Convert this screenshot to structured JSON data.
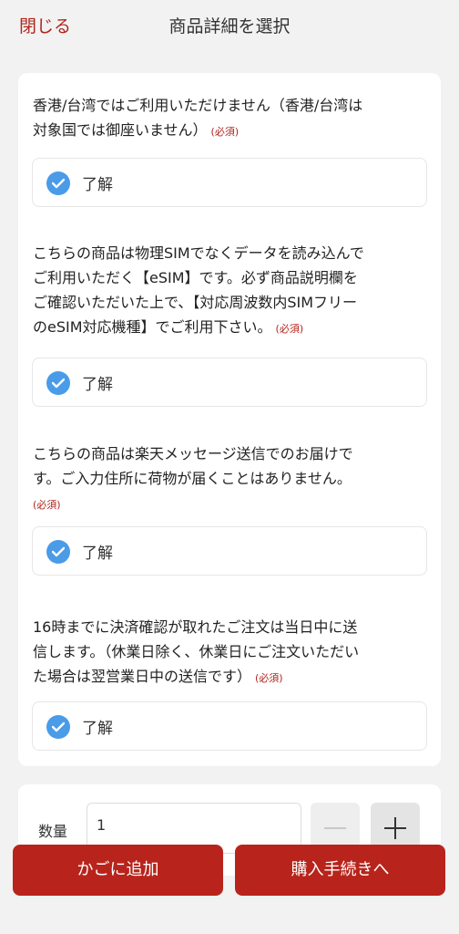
{
  "header": {
    "close_label": "閉じる",
    "title": "商品詳細を選択"
  },
  "questions": [
    {
      "text_lines": [
        "香港/台湾ではご利用いただけません（香港/台湾は",
        "対象国では御座いません）"
      ],
      "required": "(必須)",
      "option": "了解"
    },
    {
      "text_lines": [
        "こちらの商品は物理SIMでなくデータを読み込んで",
        "ご利用いただく【eSIM】です。必ず商品説明欄を",
        "ご確認いただいた上で、【対応周波数内SIMフリー",
        "のeSIM対応機種】でご利用下さい。"
      ],
      "required": "(必須)",
      "option": "了解"
    },
    {
      "text_lines": [
        "こちらの商品は楽天メッセージ送信でのお届けで",
        "す。ご入力住所に荷物が届くことはありません。"
      ],
      "required": "(必須)",
      "option": "了解"
    },
    {
      "text_lines": [
        "16時までに決済確認が取れたご注文は当日中に送",
        "信します。（休業日除く、休業日にご注文いただい",
        "た場合は翌営業日中の送信です）"
      ],
      "required": "(必須)",
      "option": "了解"
    }
  ],
  "quantity": {
    "label": "数量",
    "value": "1"
  },
  "buttons": {
    "add_to_cart": "かごに追加",
    "checkout": "購入手続きへ"
  },
  "colors": {
    "accent": "#b8241c",
    "check": "#4a9be8"
  }
}
